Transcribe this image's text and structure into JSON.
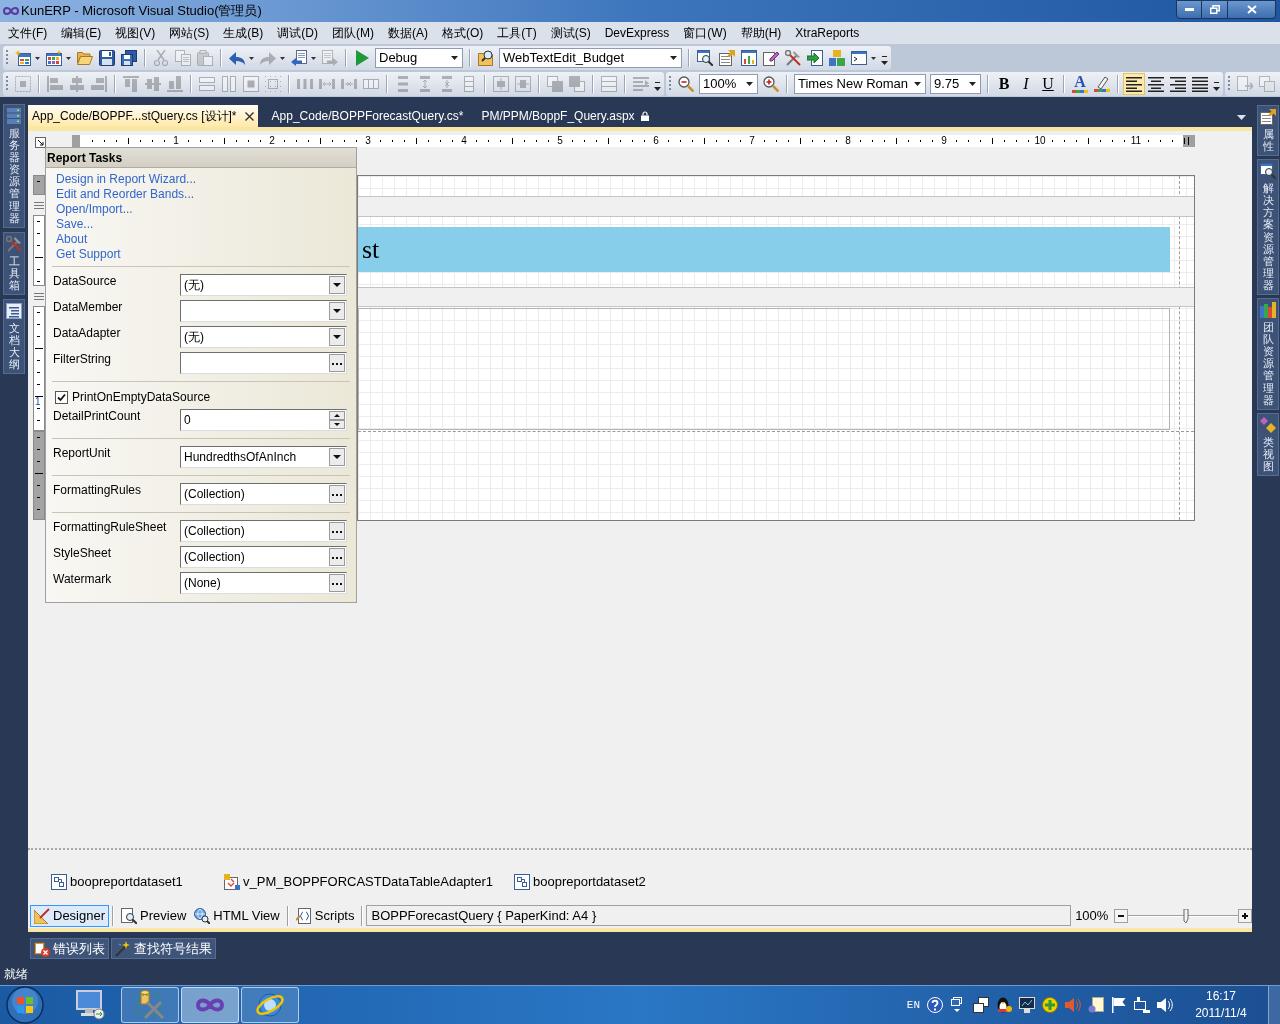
{
  "window": {
    "title": "KunERP - Microsoft Visual Studio(管理员)"
  },
  "menu": [
    "文件(F)",
    "编辑(E)",
    "视图(V)",
    "网站(S)",
    "生成(B)",
    "调试(D)",
    "团队(M)",
    "数据(A)",
    "格式(O)",
    "工具(T)",
    "测试(S)",
    "DevExpress",
    "窗口(W)",
    "帮助(H)",
    "XtraReports"
  ],
  "standard_toolbar": {
    "groups": [
      [
        {
          "kind": "button",
          "disabled": false,
          "dropdown": true
        },
        {
          "kind": "button",
          "disabled": false,
          "dropdown": true
        },
        {
          "kind": "button",
          "disabled": false
        },
        {
          "kind": "button",
          "disabled": false
        },
        {
          "kind": "button",
          "disabled": false
        }
      ],
      [
        {
          "kind": "button",
          "disabled": true
        },
        {
          "kind": "button",
          "disabled": true
        },
        {
          "kind": "button",
          "disabled": true
        }
      ],
      [
        {
          "kind": "button",
          "disabled": false,
          "dropdown": true
        },
        {
          "kind": "button",
          "disabled": true,
          "dropdown": true
        },
        {
          "kind": "button",
          "disabled": false,
          "dropdown": true
        },
        {
          "kind": "button",
          "disabled": true
        }
      ],
      [
        {
          "kind": "button",
          "disabled": false
        },
        {
          "kind": "combo",
          "value": "Debug"
        }
      ],
      [
        {
          "kind": "button",
          "disabled": false
        },
        {
          "kind": "combo",
          "value": "WebTextEdit_Budget"
        }
      ],
      [
        {
          "kind": "button",
          "disabled": false
        },
        {
          "kind": "button",
          "disabled": false
        },
        {
          "kind": "button",
          "disabled": false
        },
        {
          "kind": "button",
          "disabled": false
        },
        {
          "kind": "button",
          "disabled": false
        },
        {
          "kind": "button",
          "disabled": false
        },
        {
          "kind": "button",
          "disabled": false
        },
        {
          "kind": "button",
          "disabled": false,
          "dropdown": true
        }
      ]
    ]
  },
  "layout_toolbar": {
    "groups": [
      [
        {
          "kind": "button",
          "disabled": true
        }
      ],
      [
        {
          "kind": "button",
          "disabled": true
        },
        {
          "kind": "button",
          "disabled": true
        },
        {
          "kind": "button",
          "disabled": true
        }
      ],
      [
        {
          "kind": "button",
          "disabled": true
        },
        {
          "kind": "button",
          "disabled": true
        },
        {
          "kind": "button",
          "disabled": true
        }
      ],
      [
        {
          "kind": "button",
          "disabled": true
        },
        {
          "kind": "button",
          "disabled": true
        },
        {
          "kind": "button",
          "disabled": true
        },
        {
          "kind": "button",
          "disabled": true
        }
      ],
      [
        {
          "kind": "button",
          "disabled": true
        },
        {
          "kind": "button",
          "disabled": true
        },
        {
          "kind": "button",
          "disabled": true
        },
        {
          "kind": "button",
          "disabled": true
        }
      ],
      [
        {
          "kind": "button",
          "disabled": true
        },
        {
          "kind": "button",
          "disabled": true
        },
        {
          "kind": "button",
          "disabled": true
        },
        {
          "kind": "button",
          "disabled": true
        }
      ],
      [
        {
          "kind": "button",
          "disabled": true
        },
        {
          "kind": "button",
          "disabled": true
        }
      ],
      [
        {
          "kind": "button",
          "disabled": true
        },
        {
          "kind": "button",
          "disabled": true
        }
      ],
      [
        {
          "kind": "button",
          "disabled": true
        }
      ],
      [
        {
          "kind": "button",
          "disabled": true
        }
      ]
    ]
  },
  "format_toolbar": {
    "groups": [
      [
        {
          "kind": "button",
          "disabled": false
        },
        {
          "kind": "combo",
          "value": "100%"
        },
        {
          "kind": "button",
          "disabled": false
        }
      ],
      [
        {
          "kind": "combo",
          "value": "Times New Roman"
        },
        {
          "kind": "combo",
          "value": "9.75"
        }
      ],
      [
        {
          "kind": "bold",
          "label": "B"
        },
        {
          "kind": "italic",
          "label": "I"
        },
        {
          "kind": "underline",
          "label": "U"
        }
      ],
      [
        {
          "kind": "font-color",
          "label": "A"
        },
        {
          "kind": "button",
          "disabled": false
        }
      ],
      [
        {
          "kind": "button",
          "disabled": false,
          "selected": true
        },
        {
          "kind": "button",
          "disabled": false,
          "selected": false
        },
        {
          "kind": "button",
          "disabled": false,
          "selected": false
        },
        {
          "kind": "button",
          "disabled": false,
          "selected": false
        }
      ]
    ]
  },
  "arrange_toolbar": {
    "groups": [
      [
        {
          "kind": "button",
          "disabled": true
        },
        {
          "kind": "button",
          "disabled": true
        }
      ]
    ]
  },
  "left_dock": [
    "服务器资源管理器",
    "工具箱",
    "文档大纲"
  ],
  "right_dock": [
    "属性",
    "解决方案资源管理器",
    "团队资源管理器",
    "类视图"
  ],
  "document_tabs": [
    {
      "label": "App_Code/BOPPF...stQuery.cs [设计]*",
      "selected": true,
      "locked": false
    },
    {
      "label": "App_Code/BOPPForecastQuery.cs*",
      "selected": false,
      "locked": false
    },
    {
      "label": "PM/PPM/BoppF_Query.aspx",
      "selected": false,
      "locked": true
    }
  ],
  "ruler": {
    "labels": [
      "1",
      "2",
      "3",
      "4",
      "5",
      "6",
      "7",
      "8",
      "9",
      "10",
      "11"
    ]
  },
  "vertical_ruler": {
    "labels": [
      "1"
    ]
  },
  "report": {
    "title_label": "st"
  },
  "report_tasks": {
    "title": "Report Tasks",
    "links": [
      "Design in Report Wizard...",
      "Edit and Reorder Bands...",
      "Open/Import...",
      "Save...",
      "About",
      "Get Support"
    ],
    "property_groups": [
      [
        {
          "kind": "dropdown",
          "label": "DataSource",
          "value": "(无)"
        },
        {
          "kind": "dropdown",
          "label": "DataMember"
        },
        {
          "kind": "dropdown",
          "label": "DataAdapter",
          "value": "(无)"
        },
        {
          "kind": "dialog",
          "label": "FilterString"
        }
      ],
      [
        {
          "kind": "checkbox",
          "label": "PrintOnEmptyDataSource",
          "checked": true
        },
        {
          "kind": "spin",
          "label": "DetailPrintCount",
          "value": "0"
        }
      ],
      [
        {
          "kind": "dropdown",
          "label": "ReportUnit",
          "value": "HundredthsOfAnInch"
        }
      ],
      [
        {
          "kind": "dialog",
          "label": "FormattingRules",
          "value": "(Collection)"
        }
      ],
      [
        {
          "kind": "dialog",
          "label": "FormattingRuleSheet",
          "value": "(Collection)"
        },
        {
          "kind": "dialog",
          "label": "StyleSheet",
          "value": "(Collection)"
        },
        {
          "kind": "dialog",
          "label": "Watermark",
          "value": "(None)"
        }
      ]
    ]
  },
  "component_tray": [
    {
      "kind": "dataset",
      "label": "boopreportdataset1"
    },
    {
      "kind": "adapter",
      "label": "v_PM_BOPPFORCASTDataTableAdapter1"
    },
    {
      "kind": "dataset",
      "label": "boopreportdataset2"
    }
  ],
  "view_tabs": [
    {
      "label": "Designer",
      "selected": true
    },
    {
      "label": "Preview",
      "selected": false
    },
    {
      "label": "HTML View",
      "selected": false
    },
    {
      "label": "Scripts",
      "selected": false
    }
  ],
  "report_info": "BOPPForecastQuery { PaperKind: A4 }",
  "zoom": {
    "reading": "100%",
    "level": 0.53
  },
  "tool_window_tabs": [
    "错误列表",
    "查找符号结果"
  ],
  "status_bar": {
    "text": "就绪"
  },
  "taskbar": {
    "apps": [
      {
        "running": false,
        "selected": false
      },
      {
        "running": true,
        "selected": false
      },
      {
        "running": true,
        "selected": true
      },
      {
        "running": true,
        "selected": false
      }
    ],
    "language": "EN",
    "time": "16:17",
    "date": "2011/11/4"
  }
}
